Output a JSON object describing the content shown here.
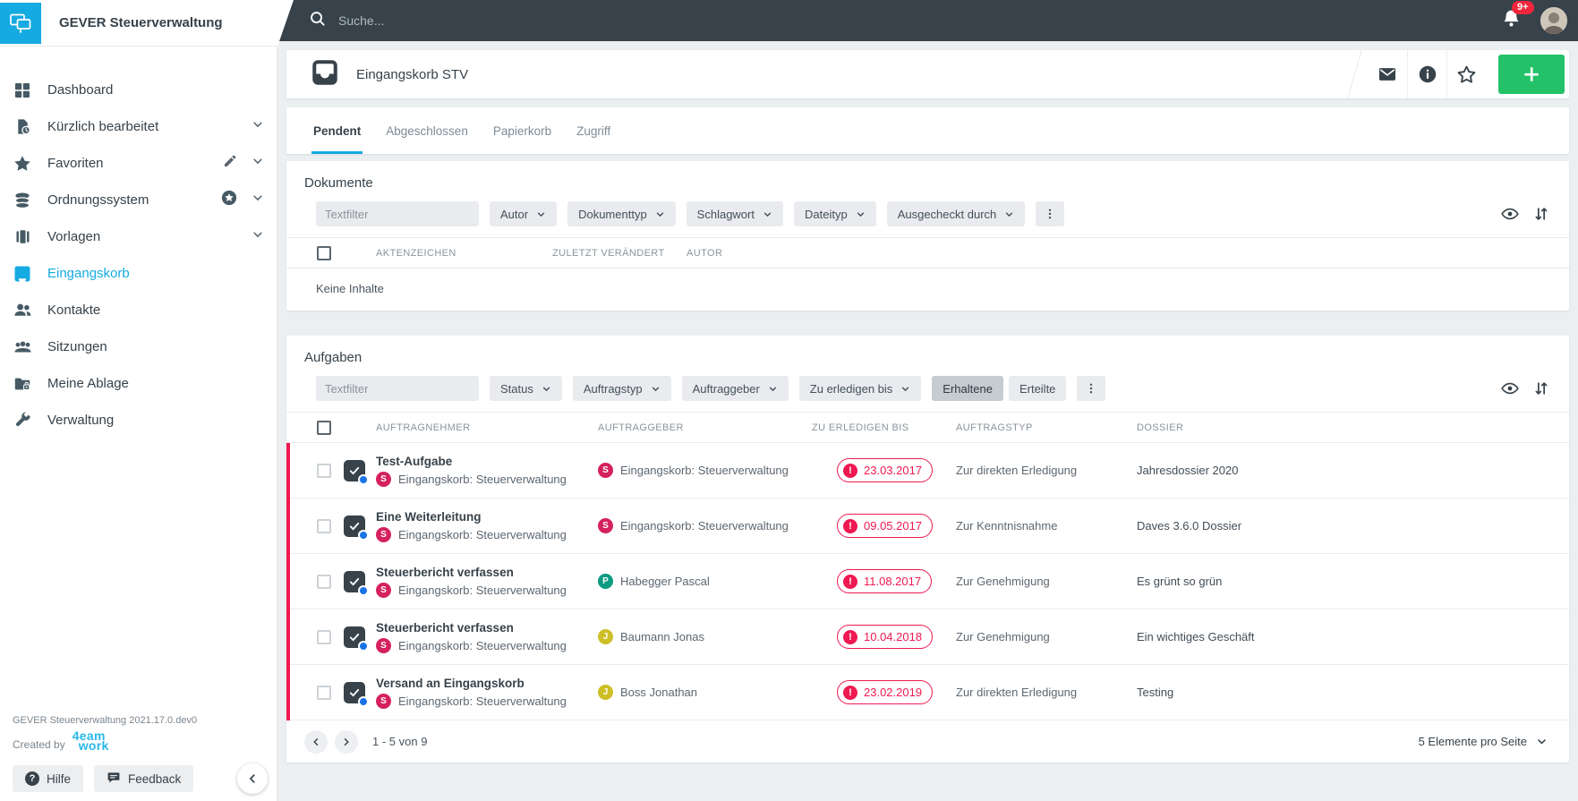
{
  "brand": {
    "app_title": "GEVER Steuerverwaltung",
    "version": "GEVER Steuerverwaltung 2021.17.0.dev0",
    "created_by_label": "Created by",
    "logo_line1": "4eam",
    "logo_line2": "work"
  },
  "colors": {
    "accent_cyan": "#15aae1",
    "topbar_dark": "#37424a",
    "add_green": "#23c268",
    "alert_red": "#ef1951",
    "background_gray": "#eceff1"
  },
  "topbar": {
    "search_placeholder": "Suche...",
    "notifications_badge": "9+"
  },
  "sidebar": {
    "items": [
      {
        "label": "Dashboard",
        "icon": "dashboard-icon"
      },
      {
        "label": "Kürzlich bearbeitet",
        "icon": "recent-document-icon",
        "expandable": true
      },
      {
        "label": "Favoriten",
        "icon": "star-icon",
        "editable": true,
        "expandable": true
      },
      {
        "label": "Ordnungssystem",
        "icon": "repository-icon",
        "favorite_marker": true,
        "expandable": true
      },
      {
        "label": "Vorlagen",
        "icon": "templates-icon",
        "expandable": true
      },
      {
        "label": "Eingangskorb",
        "icon": "inbox-icon",
        "active": true
      },
      {
        "label": "Kontakte",
        "icon": "contacts-icon"
      },
      {
        "label": "Sitzungen",
        "icon": "meetings-icon"
      },
      {
        "label": "Meine Ablage",
        "icon": "private-folder-icon"
      },
      {
        "label": "Verwaltung",
        "icon": "wrench-icon"
      }
    ],
    "help_label": "Hilfe",
    "feedback_label": "Feedback"
  },
  "header": {
    "title": "Eingangskorb STV"
  },
  "tabs": [
    {
      "label": "Pendent",
      "active": true
    },
    {
      "label": "Abgeschlossen",
      "active": false
    },
    {
      "label": "Papierkorb",
      "active": false
    },
    {
      "label": "Zugriff",
      "active": false
    }
  ],
  "documents": {
    "heading": "Dokumente",
    "textfilter_placeholder": "Textfilter",
    "filters": [
      "Autor",
      "Dokumenttyp",
      "Schlagwort",
      "Dateityp",
      "Ausgecheckt durch"
    ],
    "columns": [
      "AKTENZEICHEN",
      "ZULETZT VERÄNDERT",
      "AUTOR"
    ],
    "empty_text": "Keine Inhalte"
  },
  "tasks": {
    "heading": "Aufgaben",
    "textfilter_placeholder": "Textfilter",
    "filters": [
      "Status",
      "Auftragstyp",
      "Auftraggeber",
      "Zu erledigen bis"
    ],
    "toggle": [
      {
        "label": "Erhaltene",
        "selected": true
      },
      {
        "label": "Erteilte",
        "selected": false
      }
    ],
    "columns": [
      "AUFTRAGNEHMER",
      "AUFTRAGGEBER",
      "ZU ERLEDIGEN BIS",
      "AUFTRAGSTYP",
      "DOSSIER"
    ],
    "rows": [
      {
        "title": "Test-Aufgabe",
        "assignee": {
          "initial": "S",
          "name": "Eingangskorb: Steuerverwaltung",
          "color": "#d5225f"
        },
        "issuer": {
          "initial": "S",
          "name": "Eingangskorb: Steuerverwaltung",
          "color": "#d5225f"
        },
        "due": "23.03.2017",
        "task_type": "Zur direkten Erledigung",
        "dossier": "Jahresdossier 2020"
      },
      {
        "title": "Eine Weiterleitung",
        "assignee": {
          "initial": "S",
          "name": "Eingangskorb: Steuerverwaltung",
          "color": "#d5225f"
        },
        "issuer": {
          "initial": "S",
          "name": "Eingangskorb: Steuerverwaltung",
          "color": "#d5225f"
        },
        "due": "09.05.2017",
        "task_type": "Zur Kenntnisnahme",
        "dossier": "Daves 3.6.0 Dossier"
      },
      {
        "title": "Steuerbericht verfassen",
        "assignee": {
          "initial": "S",
          "name": "Eingangskorb: Steuerverwaltung",
          "color": "#d5225f"
        },
        "issuer": {
          "initial": "P",
          "name": "Habegger Pascal",
          "color": "#0a9b82"
        },
        "due": "11.08.2017",
        "task_type": "Zur Genehmigung",
        "dossier": "Es grünt so grün"
      },
      {
        "title": "Steuerbericht verfassen",
        "assignee": {
          "initial": "S",
          "name": "Eingangskorb: Steuerverwaltung",
          "color": "#d5225f"
        },
        "issuer": {
          "initial": "J",
          "name": "Baumann Jonas",
          "color": "#cdbf27"
        },
        "due": "10.04.2018",
        "task_type": "Zur Genehmigung",
        "dossier": "Ein wichtiges Geschäft"
      },
      {
        "title": "Versand an Eingangskorb",
        "assignee": {
          "initial": "S",
          "name": "Eingangskorb: Steuerverwaltung",
          "color": "#d5225f"
        },
        "issuer": {
          "initial": "J",
          "name": "Boss Jonathan",
          "color": "#cdbf27"
        },
        "due": "23.02.2019",
        "task_type": "Zur direkten Erledigung",
        "dossier": "Testing"
      }
    ],
    "pagination": {
      "range_label": "1 - 5 von 9",
      "per_page_label": "5 Elemente pro Seite"
    }
  }
}
